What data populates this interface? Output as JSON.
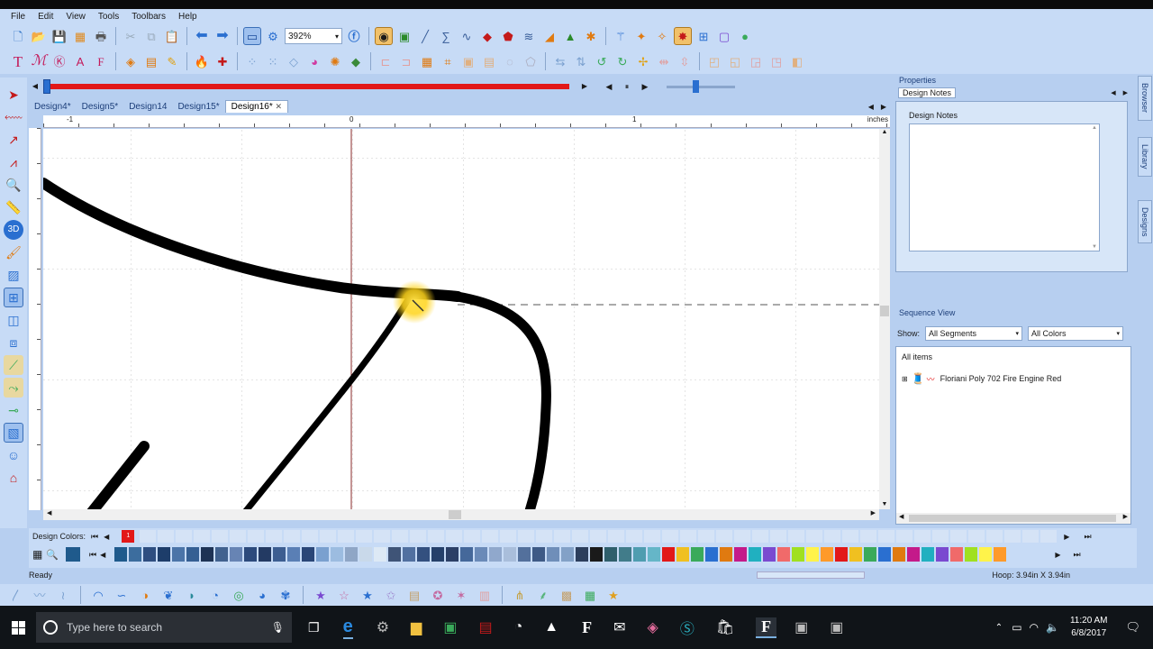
{
  "menu": [
    "File",
    "Edit",
    "View",
    "Tools",
    "Toolbars",
    "Help"
  ],
  "toolbar": {
    "zoom_value": "392%"
  },
  "doc_tabs": [
    {
      "label": "Design4*",
      "active": false
    },
    {
      "label": "Design5*",
      "active": false
    },
    {
      "label": "Design14",
      "active": false
    },
    {
      "label": "Design15*",
      "active": false
    },
    {
      "label": "Design16*",
      "active": true
    }
  ],
  "ruler": {
    "unit": "inches",
    "h_ticks": [
      "-1",
      "0",
      "1"
    ]
  },
  "properties": {
    "header": "Properties",
    "tab": "Design Notes",
    "notes_title": "Design Notes",
    "notes_text": ""
  },
  "sequence": {
    "header": "Sequence View",
    "show_label": "Show:",
    "segments_value": "All Segments",
    "colors_value": "All Colors",
    "root_label": "All items",
    "items": [
      {
        "label": "Floriani Poly 702 Fire Engine Red"
      }
    ]
  },
  "side_tabs": [
    "Browser",
    "Library",
    "Designs"
  ],
  "design_colors": {
    "label": "Design Colors:",
    "current_index": "1",
    "swatch_colors": [
      "#1f5a8c",
      "#3c6d9e",
      "#2e4e80",
      "#1d3d6a",
      "#4b74a8",
      "#355f93",
      "#1e3355",
      "#41628f",
      "#6784b4",
      "#2c4a7c",
      "#233a63",
      "#3d5e91",
      "#5a7fb5",
      "#2a4677",
      "#7aa0cf",
      "#9cbce0",
      "#8fa6c6",
      "#c9d9ea",
      "#dde9f5",
      "#3f5477",
      "#5170a0",
      "#33507f",
      "#25406a",
      "#2b3f66",
      "#45689a",
      "#6a8ab8",
      "#90a8cc",
      "#a9bedb",
      "#53709c",
      "#3e5a86",
      "#6f8eb9",
      "#83a1c7",
      "#2c3e5c",
      "#1a1a1a",
      "#2f5f6c",
      "#417c8a",
      "#4f9db0",
      "#65b6c8"
    ]
  },
  "status": {
    "left": "Ready",
    "right": "Hoop: 3.94in X 3.94in"
  },
  "taskbar": {
    "search_placeholder": "Type here to search",
    "time": "11:20 AM",
    "date": "6/8/2017"
  }
}
